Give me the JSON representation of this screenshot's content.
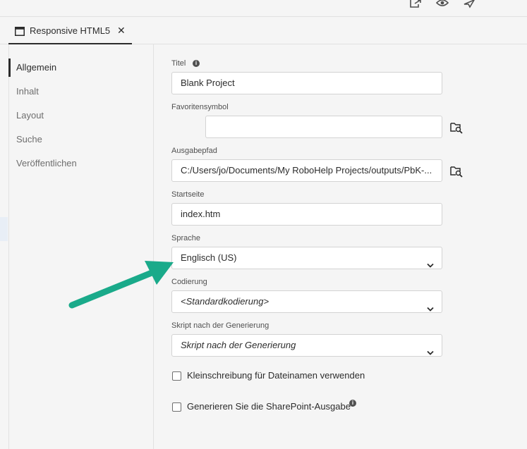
{
  "toolbar": {
    "icons": [
      "export-icon",
      "preview-icon",
      "publish-icon"
    ]
  },
  "tab": {
    "label": "Responsive HTML5",
    "close": "✕"
  },
  "sidebar": {
    "items": [
      {
        "label": "Allgemein",
        "active": true
      },
      {
        "label": "Inhalt",
        "active": false
      },
      {
        "label": "Layout",
        "active": false
      },
      {
        "label": "Suche",
        "active": false
      },
      {
        "label": "Veröffentlichen",
        "active": false
      }
    ]
  },
  "form": {
    "title": {
      "label": "Titel",
      "value": "Blank Project"
    },
    "favicon": {
      "label": "Favoritensymbol",
      "value": ""
    },
    "output_path": {
      "label": "Ausgabepfad",
      "value": "C:/Users/jo/Documents/My RoboHelp Projects/outputs/PbK-..."
    },
    "start_page": {
      "label": "Startseite",
      "value": "index.htm"
    },
    "language": {
      "label": "Sprache",
      "value": "Englisch (US)"
    },
    "encoding": {
      "label": "Codierung",
      "value": "<Standardkodierung>"
    },
    "post_script": {
      "label": "Skript nach der Generierung",
      "value": "Skript nach der Generierung"
    },
    "lowercase_checkbox": {
      "label": "Kleinschreibung für Dateinamen verwenden",
      "checked": false
    },
    "sharepoint_checkbox": {
      "label": "Generieren Sie die SharePoint-Ausgabe",
      "checked": false
    }
  },
  "colors": {
    "arrow": "#1aaa8a",
    "accent": "#2c2c2c"
  }
}
